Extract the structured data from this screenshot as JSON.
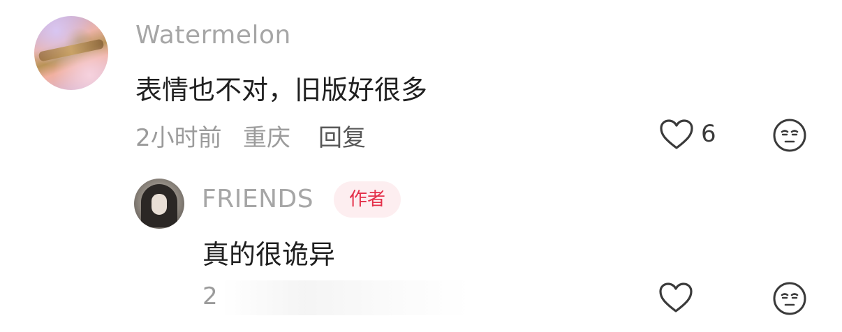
{
  "comment": {
    "username": "Watermelon",
    "text": "表情也不对，旧版好很多",
    "time": "2小时前",
    "location": "重庆",
    "reply_label": "回复",
    "like_count": "6",
    "avatar_icon": "user-avatar",
    "like_icon": "heart-outline-icon",
    "dislike_icon": "unamused-face-icon"
  },
  "reply": {
    "username": "FRIENDS",
    "badge": "作者",
    "text": "真的很诡异",
    "time": "2",
    "avatar_icon": "user-avatar",
    "like_icon": "heart-outline-icon",
    "dislike_icon": "unamused-face-icon"
  },
  "colors": {
    "username": "#a6a6a6",
    "text": "#1f1f1f",
    "meta": "#9b9b9b",
    "badge_bg": "#fdeef0",
    "badge_text": "#e4304a",
    "icon": "#3a3a3a"
  }
}
